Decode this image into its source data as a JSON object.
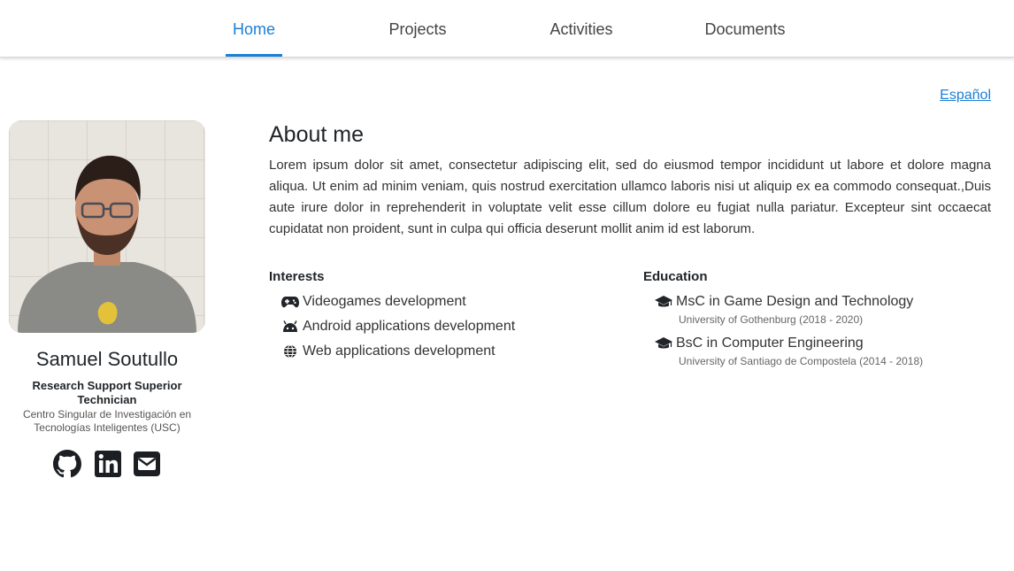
{
  "nav": {
    "tabs": [
      {
        "label": "Home",
        "active": true
      },
      {
        "label": "Projects",
        "active": false
      },
      {
        "label": "Activities",
        "active": false
      },
      {
        "label": "Documents",
        "active": false
      }
    ],
    "accent_color": "#1a7fd6"
  },
  "language_link": "Español",
  "profile": {
    "name": "Samuel Soutullo",
    "role": "Research Support Superior Technician",
    "organization": "Centro Singular de Investigación en Tecnologías Inteligentes (USC)",
    "social_icons": [
      "github-icon",
      "linkedin-icon",
      "email-icon"
    ]
  },
  "about": {
    "title": "About me",
    "text": "Lorem ipsum dolor sit amet, consectetur adipiscing elit, sed do eiusmod tempor incididunt ut labore et dolore magna aliqua. Ut enim ad minim veniam, quis nostrud exercitation ullamco laboris nisi ut aliquip ex ea commodo consequat.,Duis aute irure dolor in reprehenderit in voluptate velit esse cillum dolore eu fugiat nulla pariatur. Excepteur sint occaecat cupidatat non proident, sunt in culpa qui officia deserunt mollit anim id est laborum."
  },
  "interests": {
    "title": "Interests",
    "items": [
      {
        "label": "Videogames development",
        "icon": "gamepad-icon"
      },
      {
        "label": "Android applications development",
        "icon": "android-icon"
      },
      {
        "label": "Web applications development",
        "icon": "globe-icon"
      }
    ]
  },
  "education": {
    "title": "Education",
    "items": [
      {
        "degree": "MsC in Game Design and Technology",
        "institution": "University of Gothenburg (2018 - 2020)",
        "icon": "graduation-cap-icon"
      },
      {
        "degree": "BsC in Computer Engineering",
        "institution": "University of Santiago de Compostela (2014 - 2018)",
        "icon": "graduation-cap-icon"
      }
    ]
  }
}
